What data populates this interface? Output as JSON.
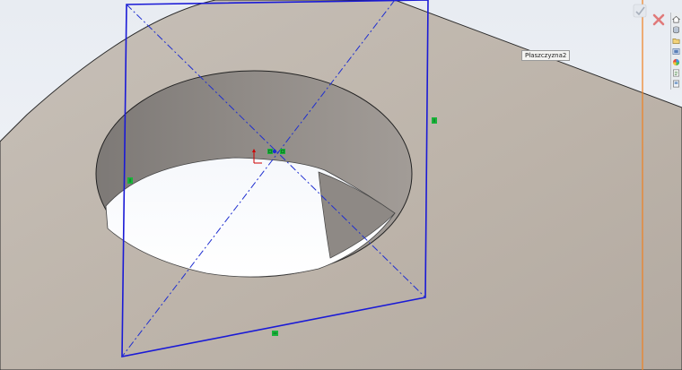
{
  "viewport": {
    "plane_tooltip": "Płaszczyzna2"
  },
  "colors": {
    "sketch_line": "#1a1ad6",
    "centerline": "#1f2fd0",
    "relation_marker": "#19b33a",
    "origin_axis_x": "#d00000",
    "origin_axis_y": "#cc0000",
    "part_face": "#beb5ab",
    "hole_wall": "#8d8884",
    "background_sky": "#eef1f6",
    "orange_guide": "#f08020"
  },
  "confirm_corner": {
    "ok_icon": "check-icon",
    "cancel_icon": "close-icon"
  },
  "task_pane": {
    "icons": [
      "home-icon",
      "parts-library-icon",
      "file-explorer-icon",
      "view-palette-icon",
      "appearances-icon",
      "custom-properties-icon",
      "document-icon"
    ]
  }
}
